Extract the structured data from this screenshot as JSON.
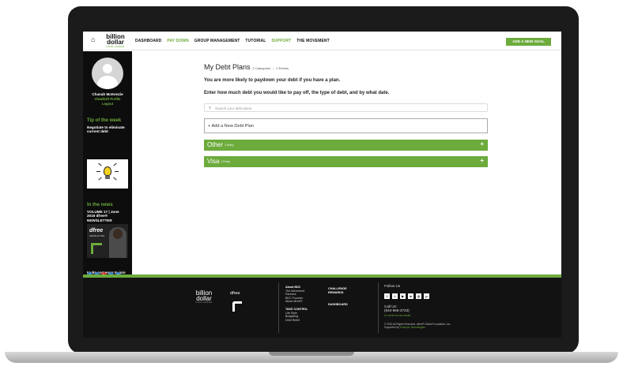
{
  "nav": {
    "logo_line1": "billion",
    "logo_line2": "dollar",
    "logo_sub": "CHALLENGE",
    "items": [
      {
        "label": "DASHBOARD",
        "active": false
      },
      {
        "label": "PAY DOWN",
        "active": true
      },
      {
        "label": "GROUP MANAGEMENT",
        "active": false
      },
      {
        "label": "TUTORIAL",
        "active": false
      },
      {
        "label": "SUPPORT",
        "active": true
      },
      {
        "label": "THE MOVEMENT",
        "active": false
      }
    ],
    "add_goal": "ADD A NEW GOAL"
  },
  "sidebar": {
    "user_name": "Chanah McKenzie",
    "edit_profile": "View/Edit Profile",
    "logout": "Logout",
    "tip_heading": "Tip of the week",
    "tip_text": "Negotiate to eliminate current debt",
    "news_heading": "In the news",
    "news_text": "VOLUME 17 | June 2019 dfree® NEWSLETTER",
    "news_brand": "dfree",
    "news_brand_sub": "NEWSLETTER",
    "invite_text": "Invite someone to join the Billion Dollar Challenge!"
  },
  "main": {
    "title": "My Debt Plans",
    "categories": "2 Categories",
    "entries": "2 Entries",
    "lead1": "You are more likely to paydown your debt if you have a plan.",
    "lead2": "Enter how much debt you would like to pay off, the type of debt, and by what date.",
    "search_placeholder": "Search your debt plans",
    "add_plan": "+ Add a New Debt Plan",
    "categories_list": [
      {
        "label": "Other",
        "count": "1 Entry",
        "plus": "+"
      },
      {
        "label": "Visa",
        "count": "1 Entry",
        "plus": "+"
      }
    ]
  },
  "footer": {
    "logo_line1": "billion",
    "logo_line2": "dollar",
    "logo_sub": "CHALLENGE",
    "dfree": "dfree",
    "about_heading": "About BDC",
    "about_links": [
      "The Movement",
      "Partners",
      "BDC Founder",
      "About dfree®"
    ],
    "take_control_heading": "TAKE CONTROL",
    "take_control_links": [
      "Life Style",
      "Budgeting",
      "Debt Relief"
    ],
    "challenge_rewards": "CHALLENGE REWARDS",
    "dashboard": "DASHBOARD",
    "follow_us": "Follow Us",
    "call_us": "Call Us:",
    "phone": "(844-655-3733)",
    "email_link": "or send us an email",
    "copyright": "© 2019 All Rights Reserved. dfree® Global Foundation, Inc.",
    "supported_by": "Supported by",
    "supporter": "Soonyon Technologies"
  },
  "colors": {
    "accent": "#6cab3c",
    "dark": "#0d0d0d"
  }
}
